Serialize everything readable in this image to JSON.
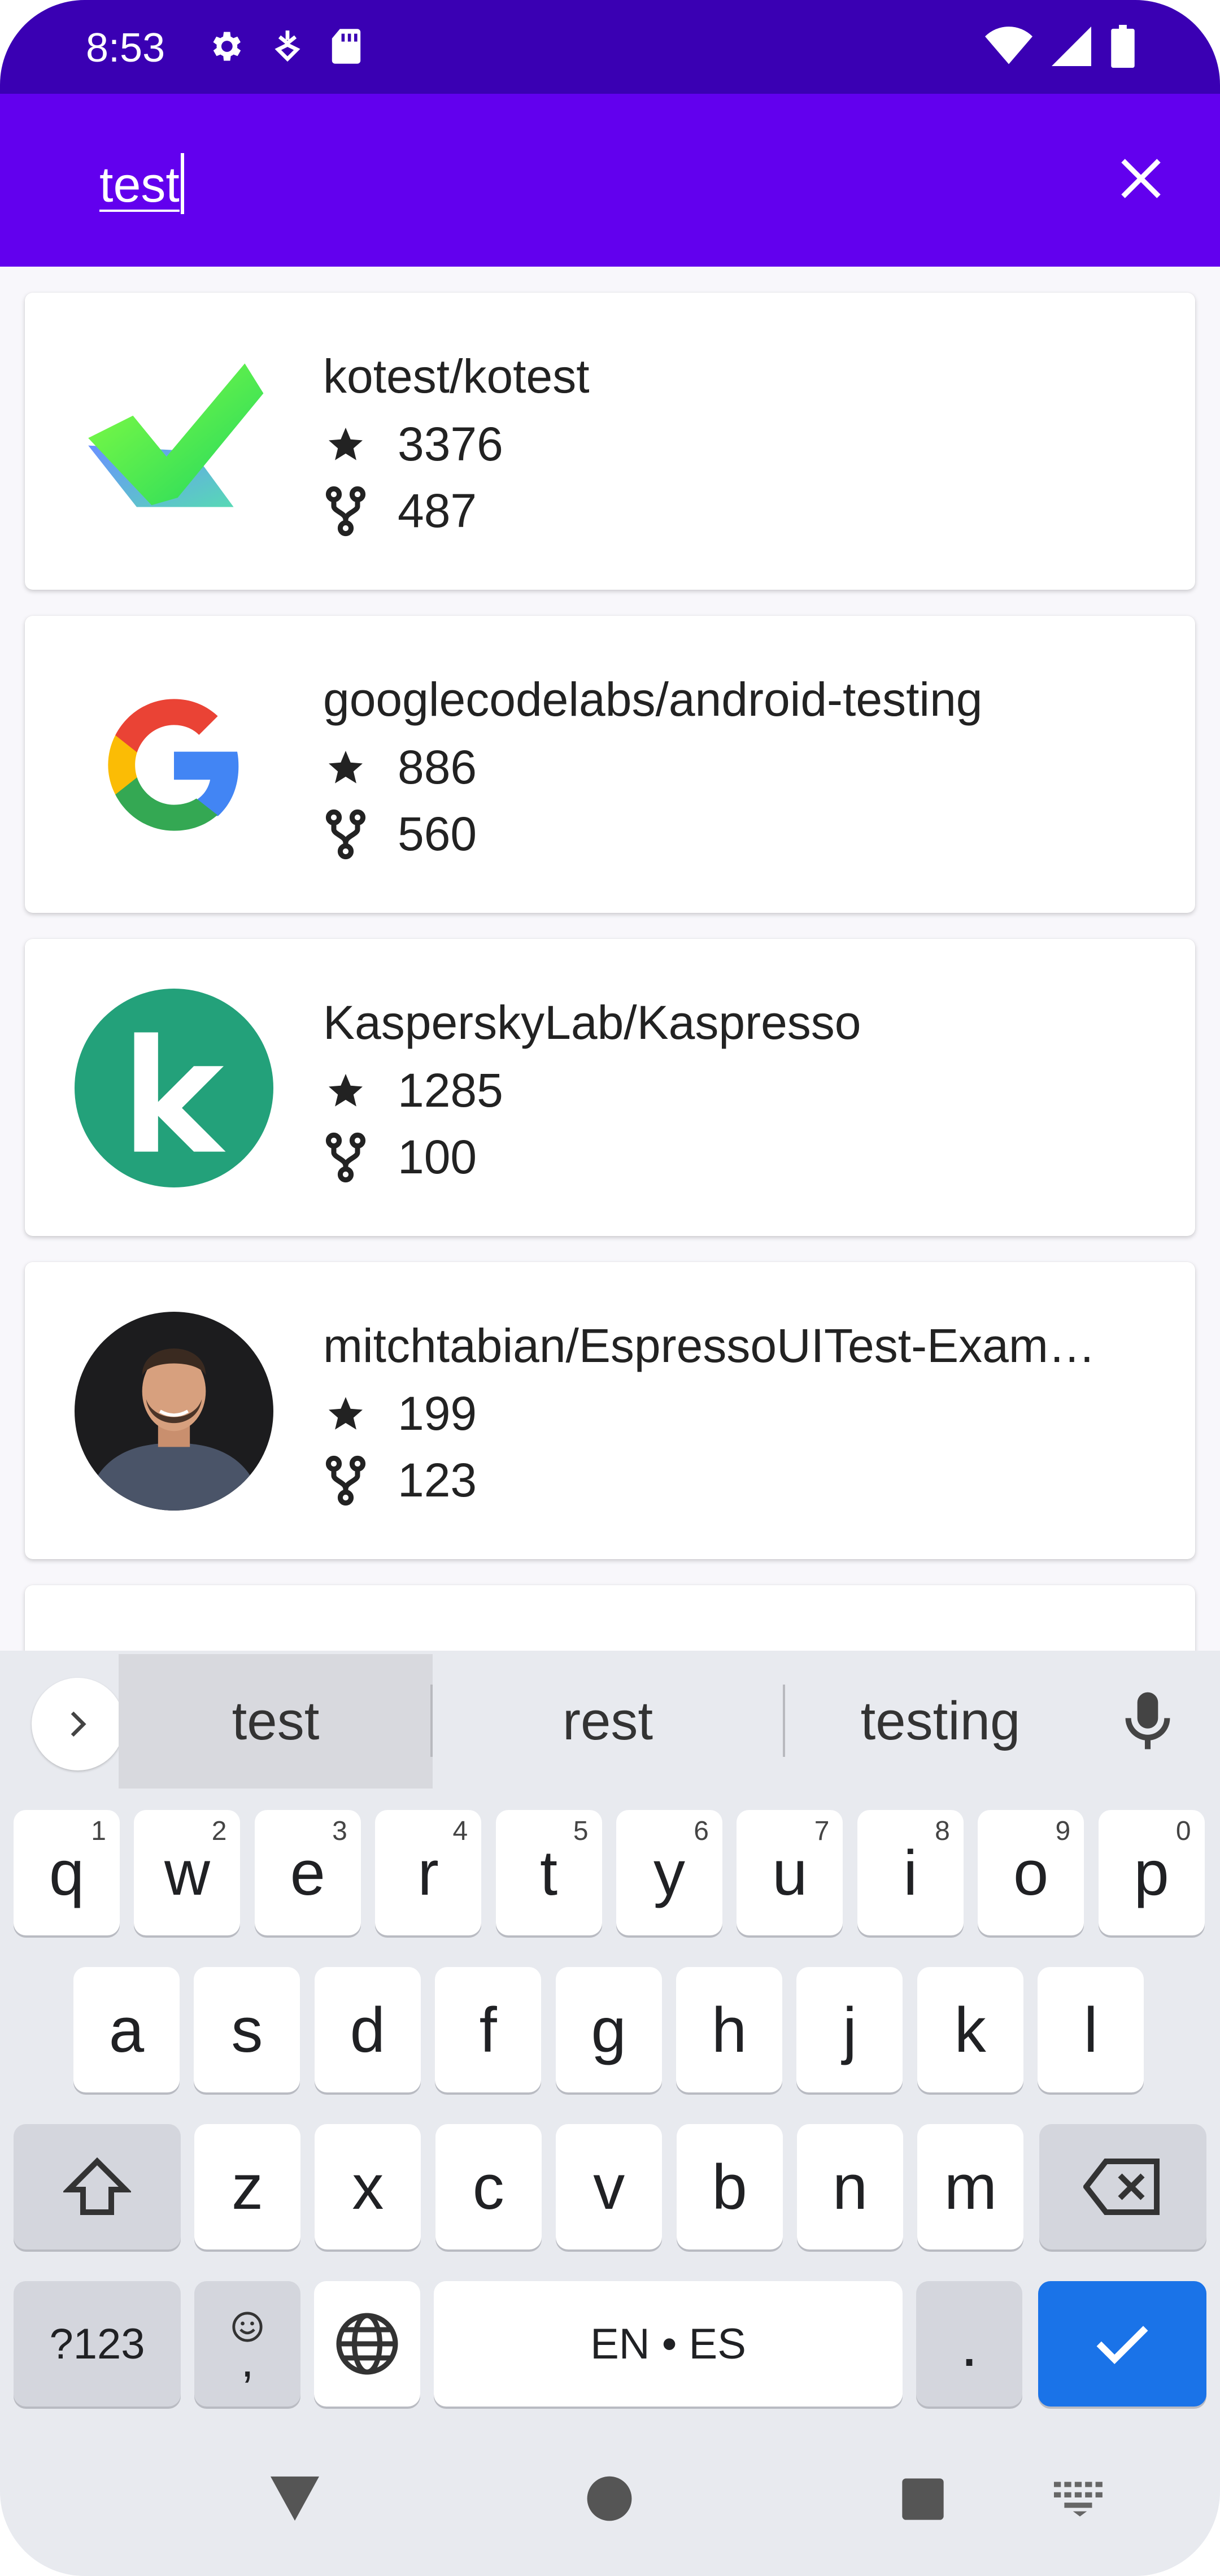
{
  "status_bar": {
    "time": "8:53",
    "left_icons": [
      "gear-icon",
      "usb-debug-icon",
      "sd-card-icon"
    ],
    "right_icons": [
      "wifi-icon",
      "cell-signal-icon",
      "battery-icon"
    ]
  },
  "app_bar": {
    "search_query": "test",
    "clear_icon": "close-icon",
    "color": "#6200ee",
    "status_color": "#3a00b3"
  },
  "results": [
    {
      "name": "kotest/kotest",
      "stars": "3376",
      "forks": "487",
      "avatar": "kotest-logo"
    },
    {
      "name": "googlecodelabs/android-testing",
      "stars": "886",
      "forks": "560",
      "avatar": "google-logo"
    },
    {
      "name": "KasperskyLab/Kaspresso",
      "stars": "1285",
      "forks": "100",
      "avatar": "kaspersky-logo"
    },
    {
      "name": "mitchtabian/EspressoUITest-Exam…",
      "stars": "199",
      "forks": "123",
      "avatar": "user-photo"
    }
  ],
  "keyboard": {
    "suggestions": [
      "test",
      "rest",
      "testing"
    ],
    "row1": [
      {
        "k": "q",
        "h": "1"
      },
      {
        "k": "w",
        "h": "2"
      },
      {
        "k": "e",
        "h": "3"
      },
      {
        "k": "r",
        "h": "4"
      },
      {
        "k": "t",
        "h": "5"
      },
      {
        "k": "y",
        "h": "6"
      },
      {
        "k": "u",
        "h": "7"
      },
      {
        "k": "i",
        "h": "8"
      },
      {
        "k": "o",
        "h": "9"
      },
      {
        "k": "p",
        "h": "0"
      }
    ],
    "row2": [
      "a",
      "s",
      "d",
      "f",
      "g",
      "h",
      "j",
      "k",
      "l"
    ],
    "row3": [
      "z",
      "x",
      "c",
      "v",
      "b",
      "n",
      "m"
    ],
    "symbols_label": "?123",
    "emoji_comma_label": ",",
    "space_label": "EN • ES",
    "period_label": ".",
    "accent_color": "#1a73e8"
  }
}
